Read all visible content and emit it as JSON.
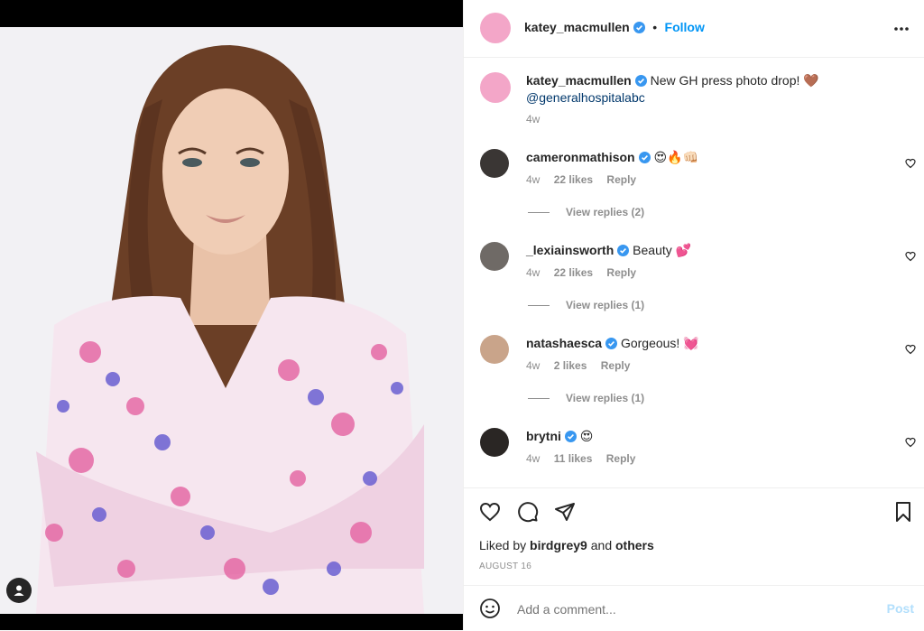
{
  "post_author": {
    "username": "katey_macmullen",
    "follow_label": "Follow",
    "dot": "•"
  },
  "more_icon": "more-horizontal-icon",
  "caption": {
    "username": "katey_macmullen",
    "text": "New GH press photo drop!",
    "emoji": "🤎",
    "mention": "@generalhospitalabc",
    "time": "4w"
  },
  "comments": [
    {
      "username": "cameronmathison",
      "text": "",
      "emoji": "😍🔥👊🏻",
      "time": "4w",
      "likes": "22 likes",
      "reply_label": "Reply",
      "view_replies": "View replies (2)"
    },
    {
      "username": "_lexiainsworth",
      "text": "Beauty",
      "emoji": "💕",
      "time": "4w",
      "likes": "22 likes",
      "reply_label": "Reply",
      "view_replies": "View replies (1)"
    },
    {
      "username": "natashaesca",
      "text": "Gorgeous!",
      "emoji": "💓",
      "time": "4w",
      "likes": "2 likes",
      "reply_label": "Reply",
      "view_replies": "View replies (1)"
    },
    {
      "username": "brytni",
      "text": "",
      "emoji": "😍",
      "time": "4w",
      "likes": "11 likes",
      "reply_label": "Reply"
    }
  ],
  "liked_by": {
    "prefix": "Liked by",
    "user": "birdgrey9",
    "and": "and",
    "others": "others"
  },
  "date": "AUGUST 16",
  "add_comment": {
    "placeholder": "Add a comment...",
    "post_label": "Post"
  },
  "colors": {
    "link": "#00376b",
    "follow": "#0095f6",
    "verified": "#3897f0",
    "muted": "#8e8e8e",
    "post_disabled": "#b2dffc"
  }
}
